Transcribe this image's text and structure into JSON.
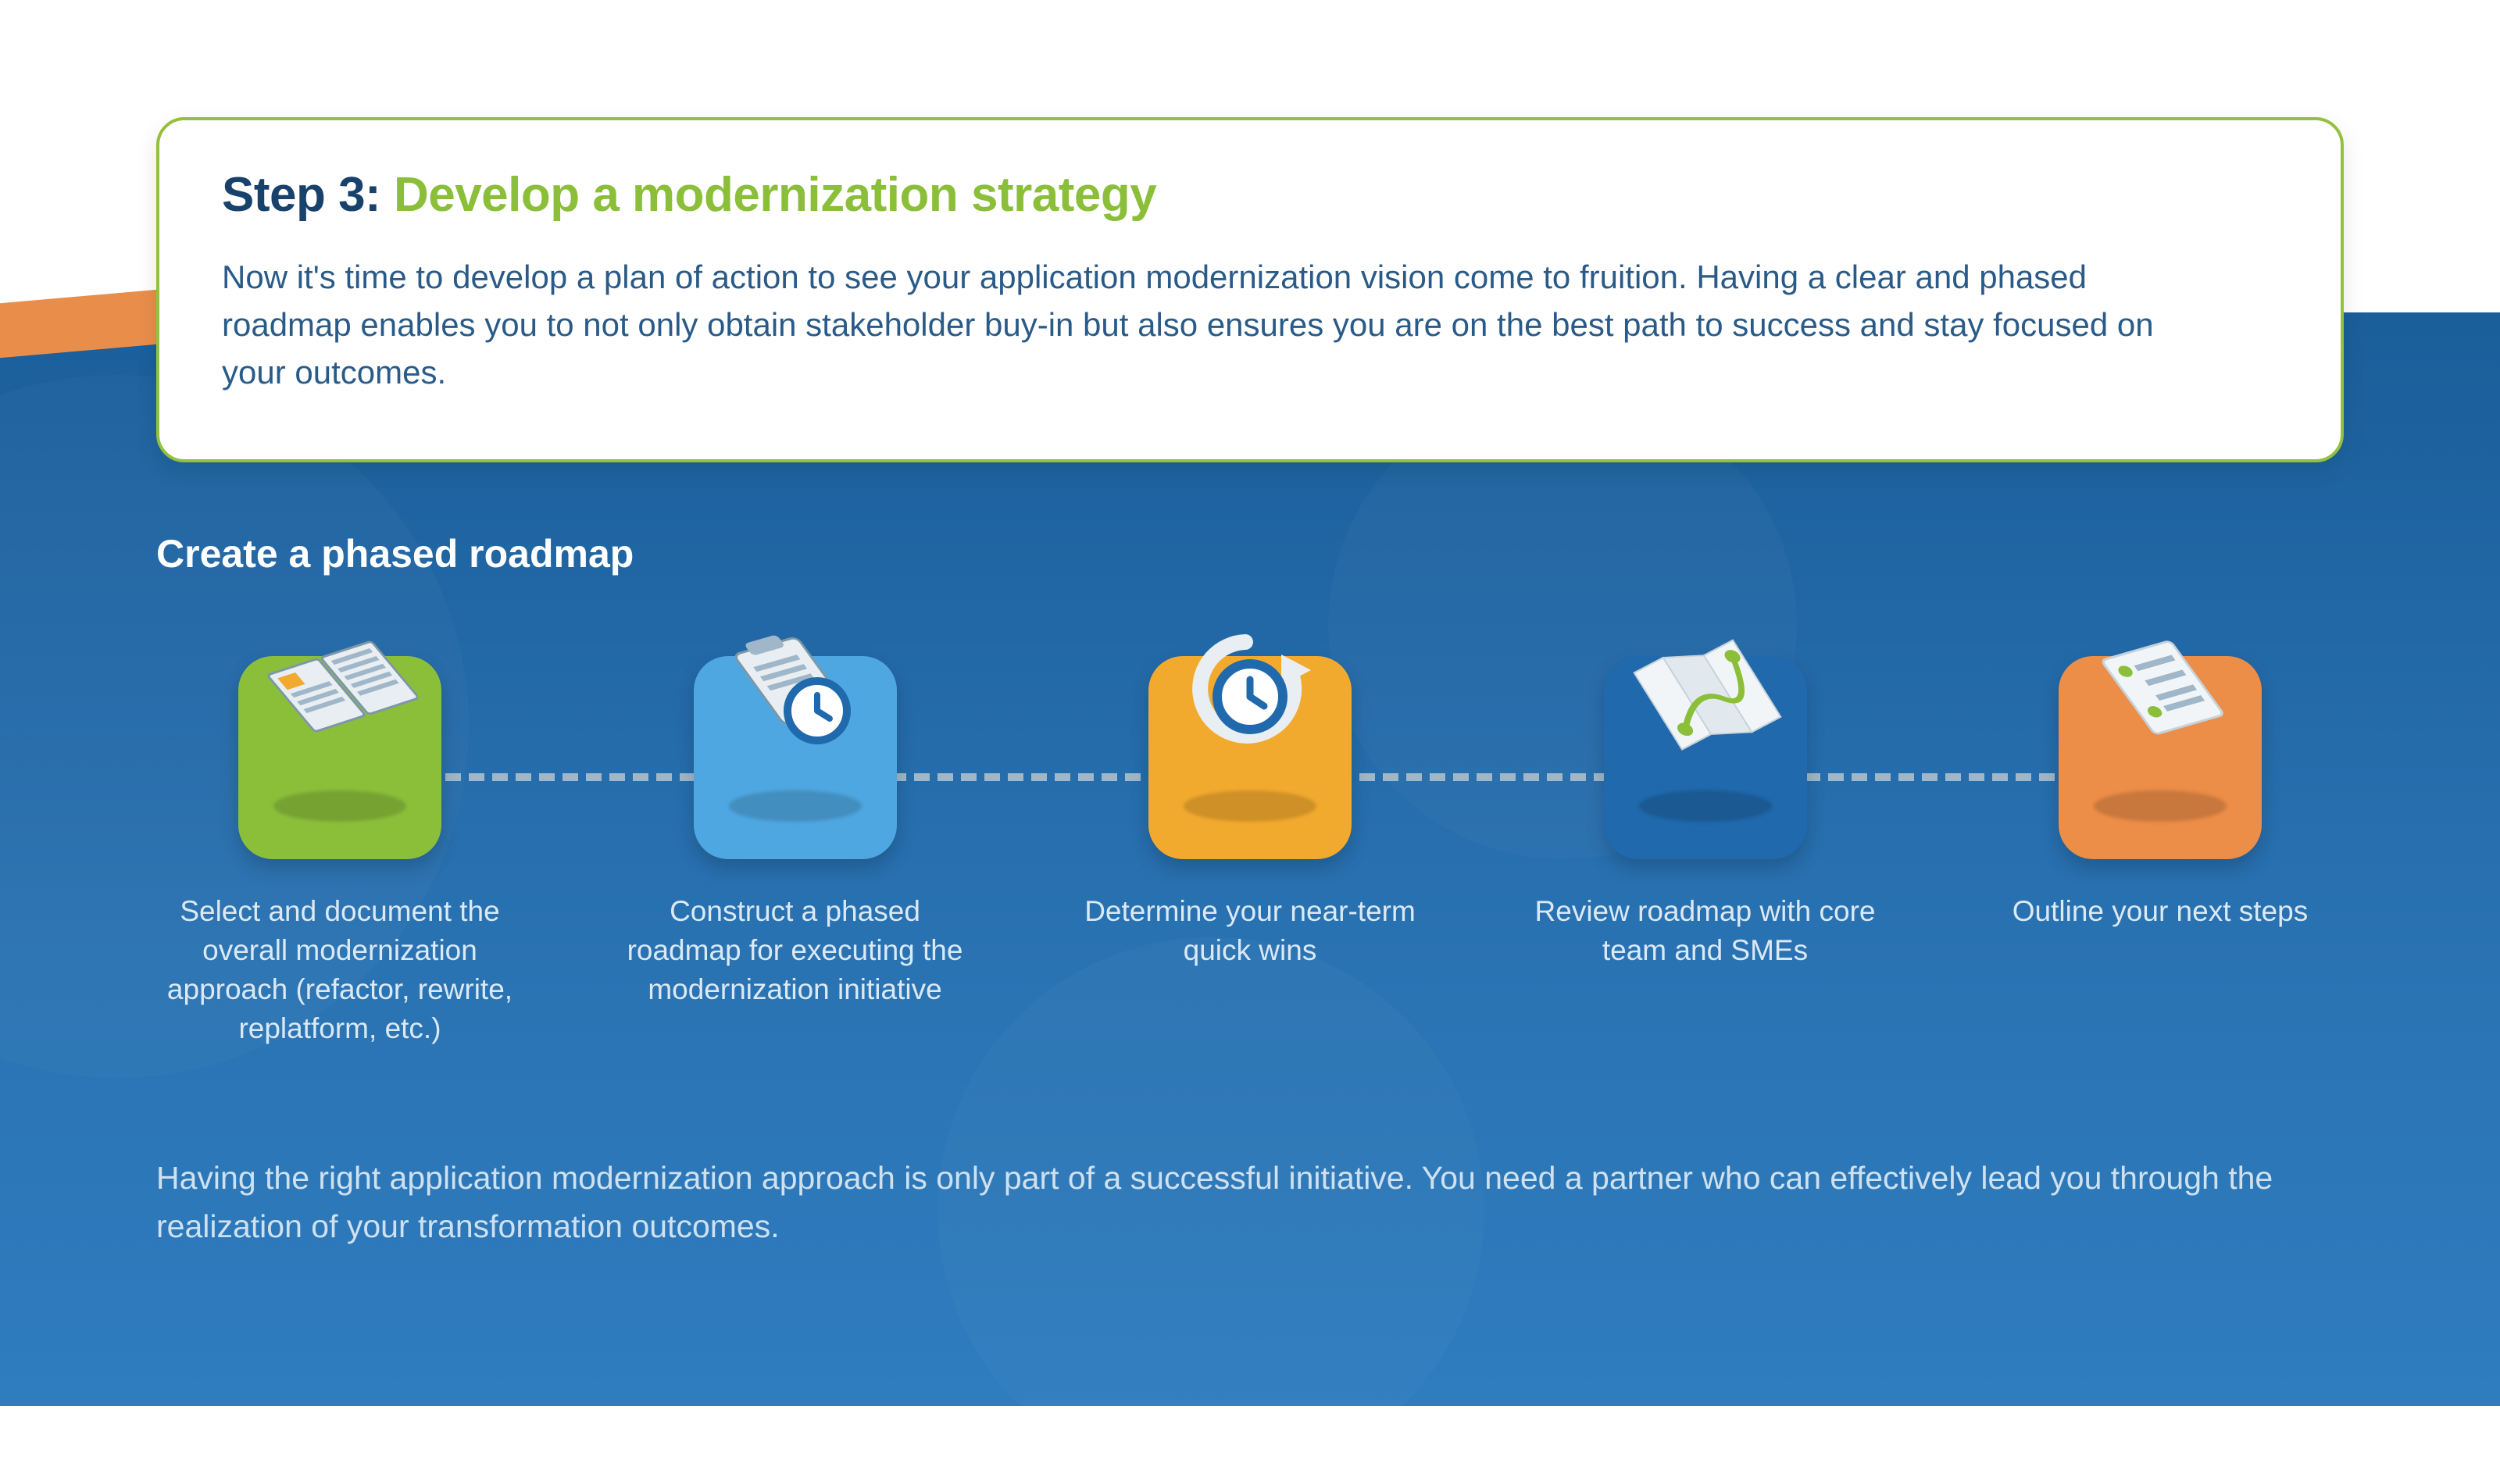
{
  "card": {
    "step_prefix": "Step 3: ",
    "step_title": "Develop a modernization strategy",
    "body": "Now it's time to develop a plan of action to see your application modernization vision come to fruition. Having a clear and phased roadmap enables you to not only obtain stakeholder buy-in but also ensures you are on the best path to success and stay focused on your outcomes."
  },
  "section_title": "Create a phased roadmap",
  "steps": [
    {
      "label": "Select and document the overall modernization approach (refactor, rewrite, replatform, etc.)",
      "tile_color": "green",
      "icon": "book"
    },
    {
      "label": "Construct a phased roadmap for executing the modernization initiative",
      "tile_color": "blue",
      "icon": "clipboard-clock"
    },
    {
      "label": "Determine your near-term quick wins",
      "tile_color": "amber",
      "icon": "refresh-clock"
    },
    {
      "label": "Review roadmap with core team and SMEs",
      "tile_color": "dblue",
      "icon": "map-route"
    },
    {
      "label": "Outline your next steps",
      "tile_color": "orange",
      "icon": "checklist"
    }
  ],
  "footer": "Having the right application modernization approach is only part of a successful initiative. You need a partner who can effectively lead you through the realization of your transformation outcomes.",
  "colors": {
    "accent_green": "#8bbf3a",
    "brand_blue": "#1a5e9a",
    "text_navy": "#18416b",
    "tile_green": "#8bbf3a",
    "tile_blue": "#4ea7e0",
    "tile_amber": "#f2aa2e",
    "tile_dblue": "#1f69ac",
    "tile_orange": "#ec8d48"
  }
}
